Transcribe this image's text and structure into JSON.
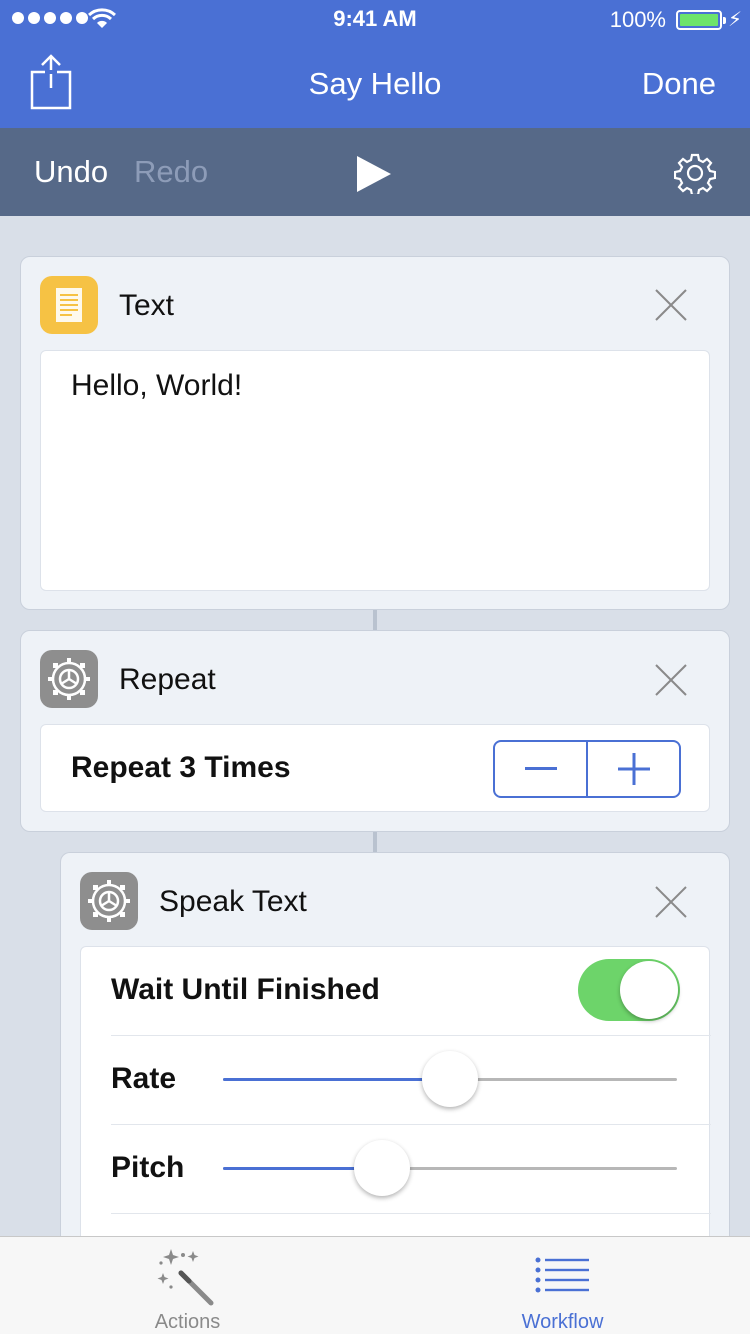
{
  "status_bar": {
    "time": "9:41 AM",
    "battery_percent": "100%"
  },
  "nav": {
    "title": "Say Hello",
    "done_label": "Done"
  },
  "toolbar": {
    "undo_label": "Undo",
    "redo_label": "Redo"
  },
  "actions": {
    "text": {
      "title": "Text",
      "content": "Hello, World!"
    },
    "repeat": {
      "title": "Repeat",
      "row_label": "Repeat 3 Times"
    },
    "speak": {
      "title": "Speak Text",
      "wait_label": "Wait Until Finished",
      "wait_enabled": true,
      "rate_label": "Rate",
      "rate_value": 0.5,
      "pitch_label": "Pitch",
      "pitch_value": 0.35
    }
  },
  "tabbar": {
    "actions_label": "Actions",
    "workflow_label": "Workflow",
    "active_tab": "Workflow"
  },
  "colors": {
    "accent": "#4a70d4",
    "toolbar": "#566988",
    "toggle_on": "#6dd46a",
    "text_icon": "#f6c244",
    "gear_icon": "#8e8e8e"
  }
}
